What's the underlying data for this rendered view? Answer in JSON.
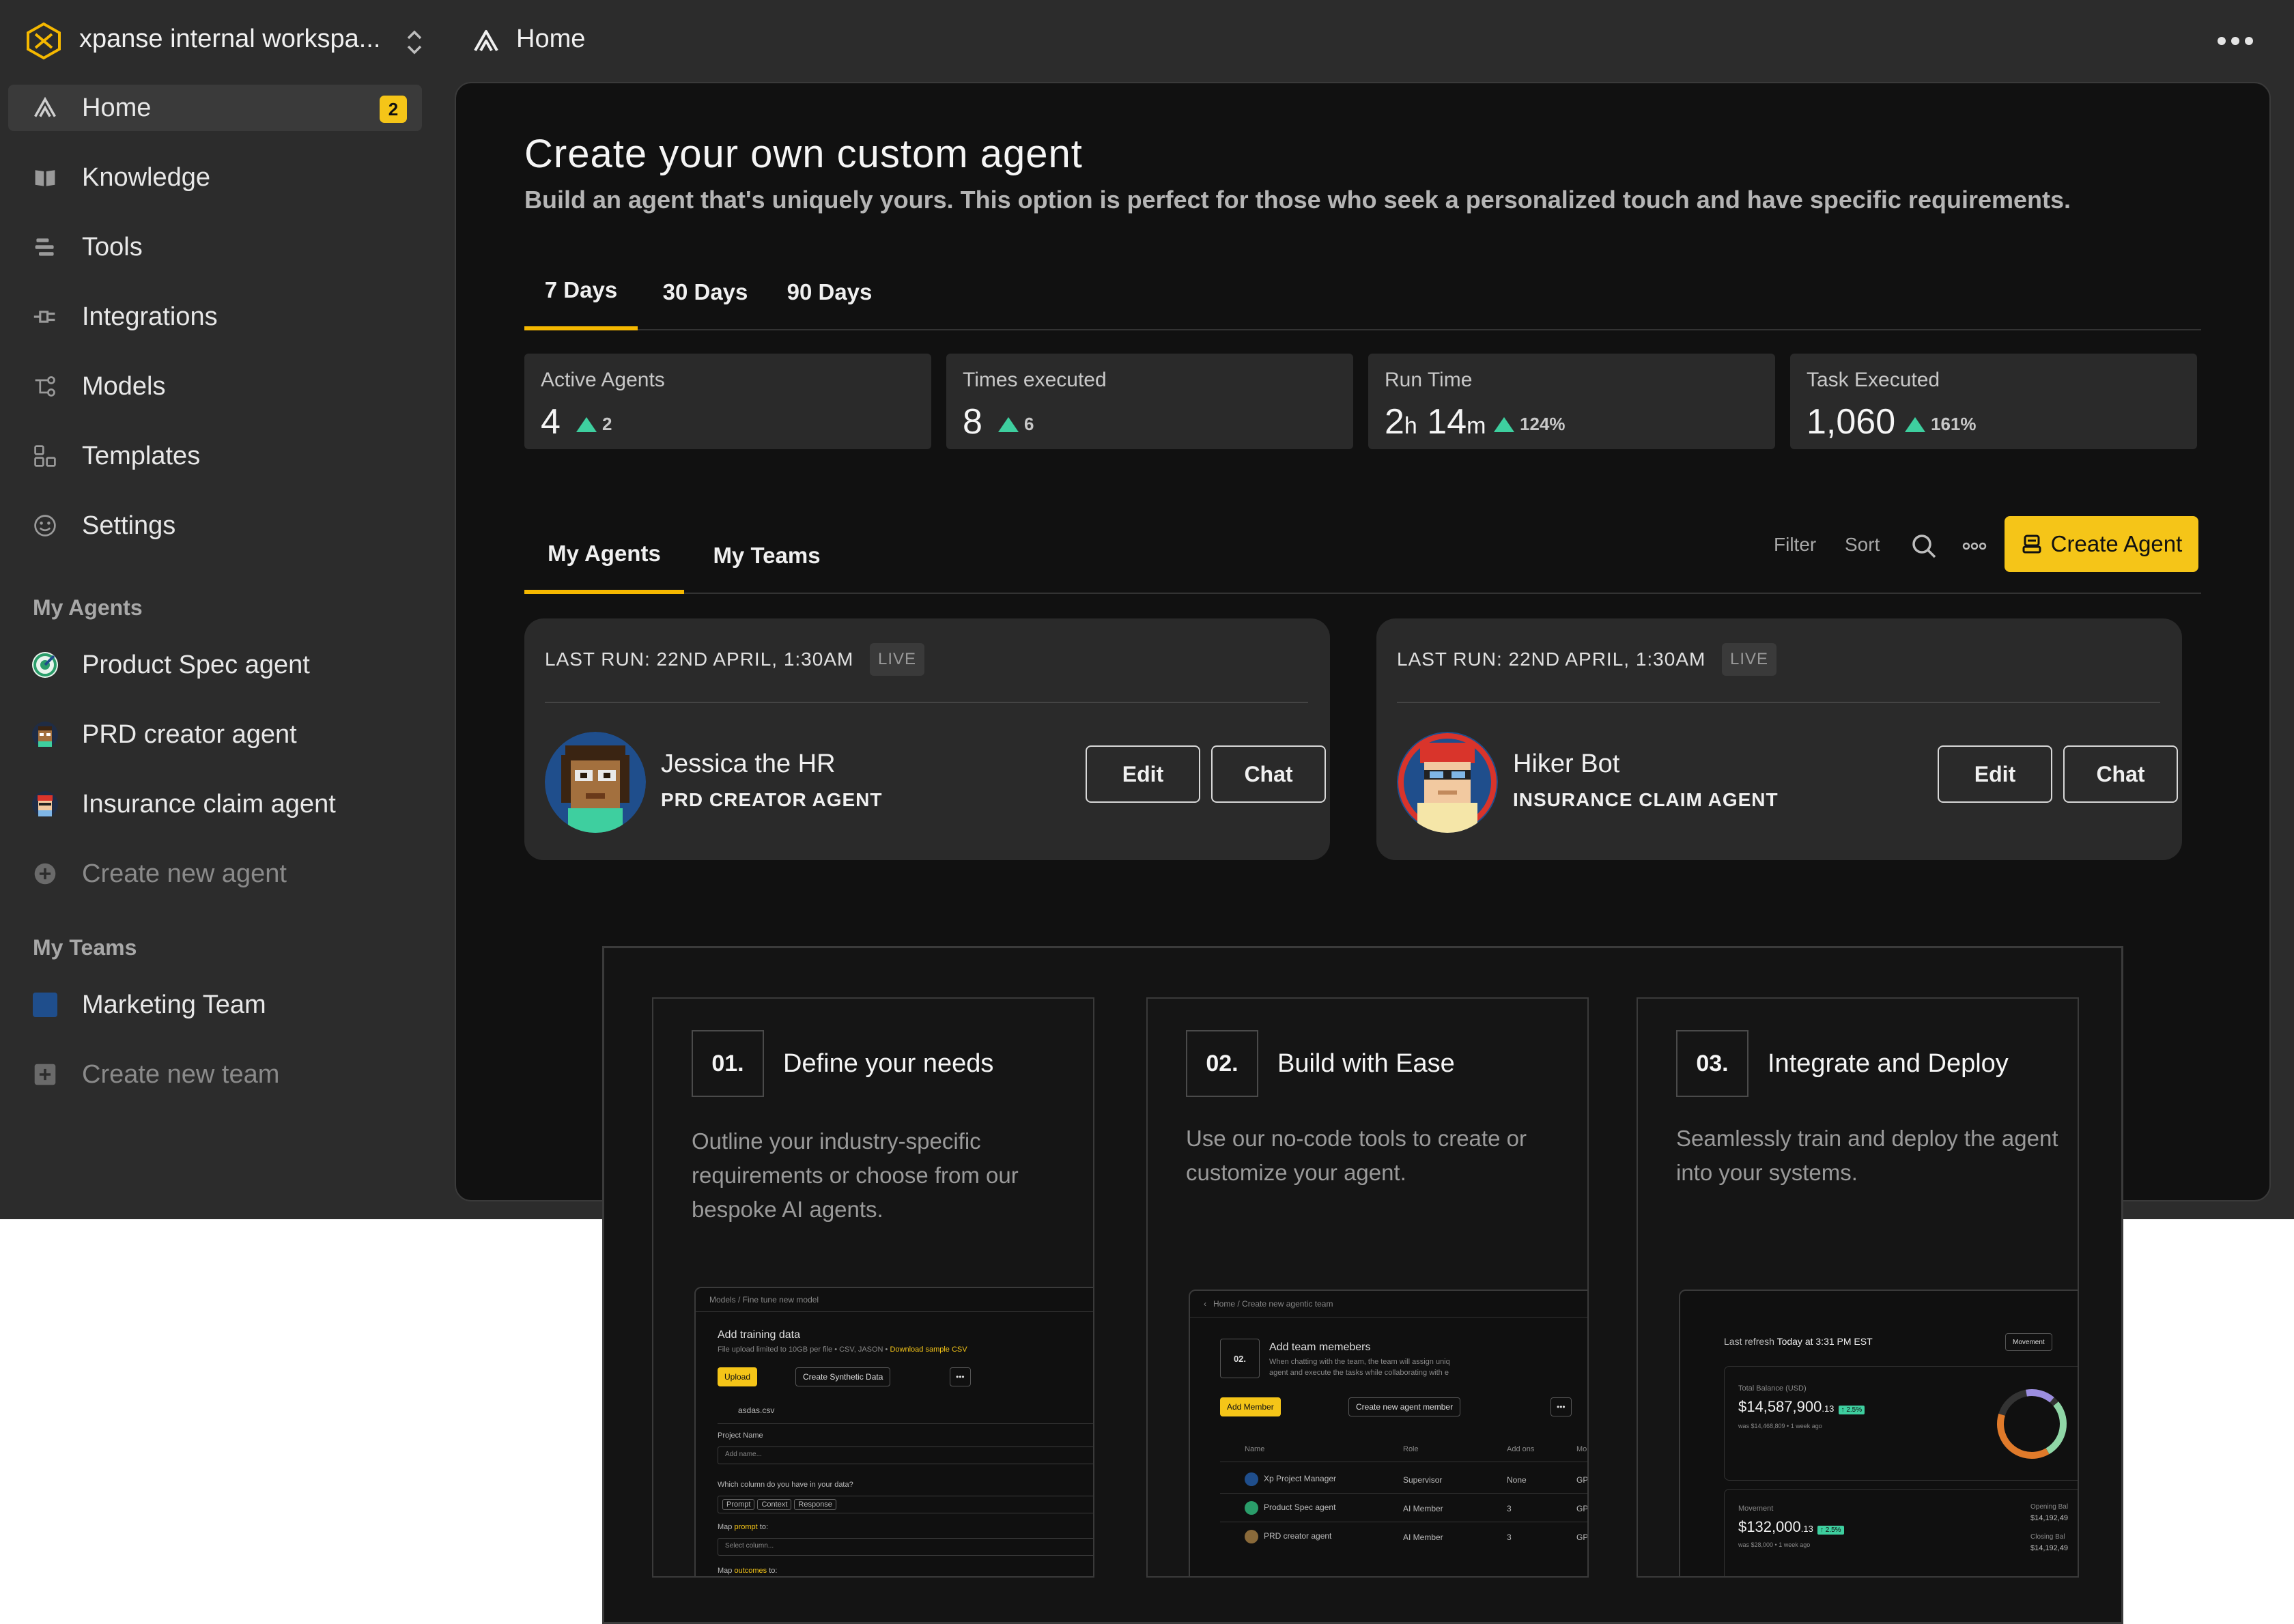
{
  "topbar": {
    "workspace_name": "xpanse internal workspa...",
    "breadcrumb": "Home"
  },
  "sidebar": {
    "nav": [
      {
        "label": "Home",
        "icon": "home-icon",
        "badge": "2",
        "active": true
      },
      {
        "label": "Knowledge",
        "icon": "book-icon"
      },
      {
        "label": "Tools",
        "icon": "tools-icon"
      },
      {
        "label": "Integrations",
        "icon": "plug-icon"
      },
      {
        "label": "Models",
        "icon": "models-icon"
      },
      {
        "label": "Templates",
        "icon": "templates-icon"
      },
      {
        "label": "Settings",
        "icon": "smiley-icon"
      }
    ],
    "agents_heading": "My Agents",
    "agents": [
      {
        "label": "Product Spec agent",
        "icon": "target-avatar"
      },
      {
        "label": "PRD creator agent",
        "icon": "pixel-avatar"
      },
      {
        "label": "Insurance claim agent",
        "icon": "pixel-avatar-red"
      }
    ],
    "create_agent": "Create new agent",
    "teams_heading": "My Teams",
    "teams": [
      {
        "label": "Marketing Team",
        "color": "#1f4e8c"
      }
    ],
    "create_team": "Create new team"
  },
  "main": {
    "title": "Create your own custom agent",
    "subtitle": "Build an agent that's uniquely yours. This option is perfect for those who seek a personalized touch and have specific requirements.",
    "range_tabs": [
      "7 Days",
      "30 Days",
      "90 Days"
    ],
    "stats": [
      {
        "label": "Active Agents",
        "value": "4",
        "unit": "",
        "delta": "2"
      },
      {
        "label": "Times executed",
        "value": "8",
        "unit": "",
        "delta": "6"
      },
      {
        "label": "Run Time",
        "value_h": "2",
        "unit_h": "h",
        "value_m": "14",
        "unit_m": "m",
        "delta": "124%"
      },
      {
        "label": "Task Executed",
        "value": "1,060",
        "unit": "",
        "delta": "161%"
      }
    ],
    "list_tabs": [
      "My Agents",
      "My Teams"
    ],
    "filter": "Filter",
    "sort": "Sort",
    "create_agent": "Create Agent",
    "agent_cards": [
      {
        "last_run": "LAST RUN: 22ND APRIL, 1:30AM",
        "status": "LIVE",
        "name": "Jessica the HR",
        "role": "PRD CREATOR AGENT",
        "edit": "Edit",
        "chat": "Chat"
      },
      {
        "last_run": "LAST RUN: 22ND APRIL, 1:30AM",
        "status": "LIVE",
        "name": "Hiker Bot",
        "role": "INSURANCE CLAIM AGENT",
        "edit": "Edit",
        "chat": "Chat"
      }
    ]
  },
  "steps": [
    {
      "num": "01.",
      "title": "Define your needs",
      "desc": "Outline your industry-specific requirements or choose from our bespoke AI agents."
    },
    {
      "num": "02.",
      "title": "Build with Ease",
      "desc": "Use our no-code tools to create or customize your agent."
    },
    {
      "num": "03.",
      "title": "Integrate and Deploy",
      "desc": "Seamlessly train and deploy the agent into your systems."
    }
  ],
  "mini1": {
    "crumb_a": "Models",
    "crumb_b": "Fine tune new model",
    "heading": "Add training data",
    "note": "File upload limited to 10GB per file • CSV, JASON •",
    "note_link": "Download sample CSV",
    "upload": "Upload",
    "synthetic": "Create Synthetic Data",
    "file": "asdas.csv",
    "project_label": "Project Name",
    "project_placeholder": "Add name...",
    "columns_label": "Which column do you have in your data?",
    "chips": [
      "Prompt",
      "Context",
      "Response"
    ],
    "map_prompt_a": "Map",
    "map_prompt_b": "prompt",
    "map_prompt_c": "to:",
    "select_placeholder": "Select column...",
    "map_out_a": "Map",
    "map_out_b": "outcomes",
    "map_out_c": "to:"
  },
  "mini2": {
    "crumb_a": "Home",
    "crumb_b": "Create new agentic team",
    "num": "02.",
    "heading": "Add team memebers",
    "desc1": "When chatting with the team, the team will assign uniq",
    "desc2": "agent and execute the tasks while collaborating with e",
    "add_member": "Add Member",
    "new_member": "Create new agent member",
    "cols": [
      "Name",
      "Role",
      "Add ons",
      "Mo"
    ],
    "rows": [
      {
        "name": "Xp Project Manager",
        "role": "Supervisor",
        "addons": "None",
        "mo": "GP",
        "color": "#1f4e8c"
      },
      {
        "name": "Product Spec agent",
        "role": "AI Member",
        "addons": "3",
        "mo": "GP",
        "color": "#2a9d6a"
      },
      {
        "name": "PRD creator agent",
        "role": "AI Member",
        "addons": "3",
        "mo": "GP",
        "color": "#8a6a3a"
      }
    ]
  },
  "mini3": {
    "refresh": "Last refresh",
    "refresh_time": "Today at 3:31 PM EST",
    "movement_btn": "Movement",
    "balance_label": "Total Balance (USD)",
    "balance": "$14,587,900",
    "balance_cents": ".13",
    "balance_delta": "↑ 2.5%",
    "balance_was": "was $14,468,809 • 1 week ago",
    "movement_label": "Movement",
    "movement": "$132,000",
    "movement_cents": ".13",
    "movement_delta": "↑ 2.5%",
    "movement_was": "was $28,000 • 1 week ago",
    "opening_label": "Opening Bal",
    "opening": "$14,192,49",
    "closing_label": "Closing Bal",
    "closing": "$14,192,49"
  }
}
